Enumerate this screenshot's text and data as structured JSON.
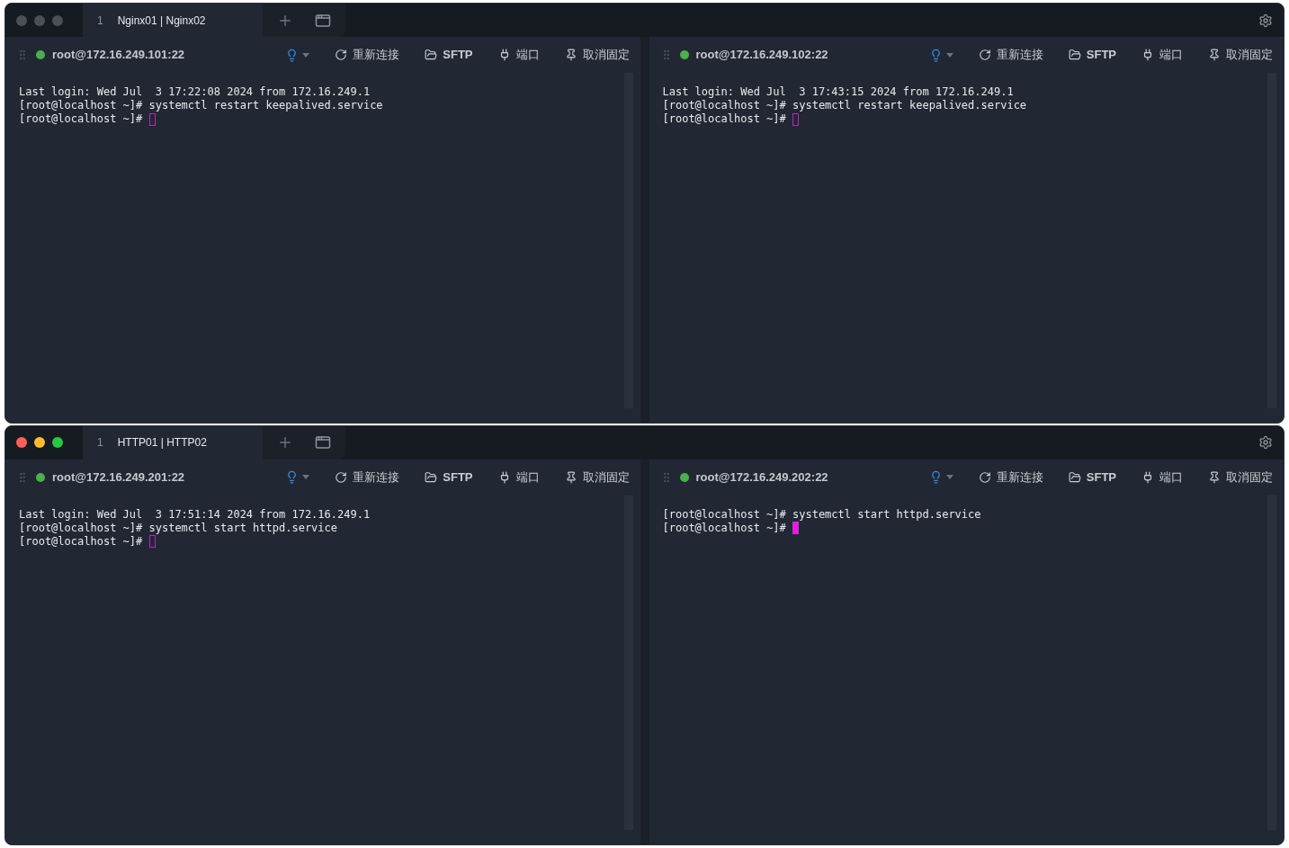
{
  "windows": [
    {
      "active": false,
      "tabs": [
        {
          "number": "1",
          "label": "Nginx01 | Nginx02",
          "selected": true
        }
      ],
      "panes": [
        {
          "host": "root@172.16.249.101:22",
          "connected": true,
          "focused": false,
          "toolbar": [
            {
              "kind": "reconnect",
              "label": "重新连接"
            },
            {
              "kind": "sftp",
              "label": "SFTP"
            },
            {
              "kind": "port",
              "label": "端口"
            },
            {
              "kind": "unpin",
              "label": "取消固定"
            }
          ],
          "lines": [
            "Last login: Wed Jul  3 17:22:08 2024 from 172.16.249.1",
            "[root@localhost ~]# systemctl restart keepalived.service",
            "[root@localhost ~]# "
          ]
        },
        {
          "host": "root@172.16.249.102:22",
          "connected": true,
          "focused": false,
          "toolbar": [
            {
              "kind": "reconnect",
              "label": "重新连接"
            },
            {
              "kind": "sftp",
              "label": "SFTP"
            },
            {
              "kind": "port",
              "label": "端口"
            },
            {
              "kind": "unpin",
              "label": "取消固定"
            }
          ],
          "lines": [
            "Last login: Wed Jul  3 17:43:15 2024 from 172.16.249.1",
            "[root@localhost ~]# systemctl restart keepalived.service",
            "[root@localhost ~]# "
          ]
        }
      ]
    },
    {
      "active": true,
      "tabs": [
        {
          "number": "1",
          "label": "HTTP01 | HTTP02",
          "selected": true
        }
      ],
      "panes": [
        {
          "host": "root@172.16.249.201:22",
          "connected": true,
          "focused": false,
          "toolbar": [
            {
              "kind": "reconnect",
              "label": "重新连接"
            },
            {
              "kind": "sftp",
              "label": "SFTP"
            },
            {
              "kind": "port",
              "label": "端口"
            },
            {
              "kind": "unpin",
              "label": "取消固定"
            }
          ],
          "lines": [
            "Last login: Wed Jul  3 17:51:14 2024 from 172.16.249.1",
            "[root@localhost ~]# systemctl start httpd.service",
            "[root@localhost ~]# "
          ]
        },
        {
          "host": "root@172.16.249.202:22",
          "connected": true,
          "focused": true,
          "toolbar": [
            {
              "kind": "reconnect",
              "label": "重新连接"
            },
            {
              "kind": "sftp",
              "label": "SFTP"
            },
            {
              "kind": "port",
              "label": "端口"
            },
            {
              "kind": "unpin",
              "label": "取消固定"
            }
          ],
          "lines": [
            "[root@localhost ~]# systemctl start httpd.service",
            "[root@localhost ~]# "
          ]
        }
      ]
    }
  ]
}
